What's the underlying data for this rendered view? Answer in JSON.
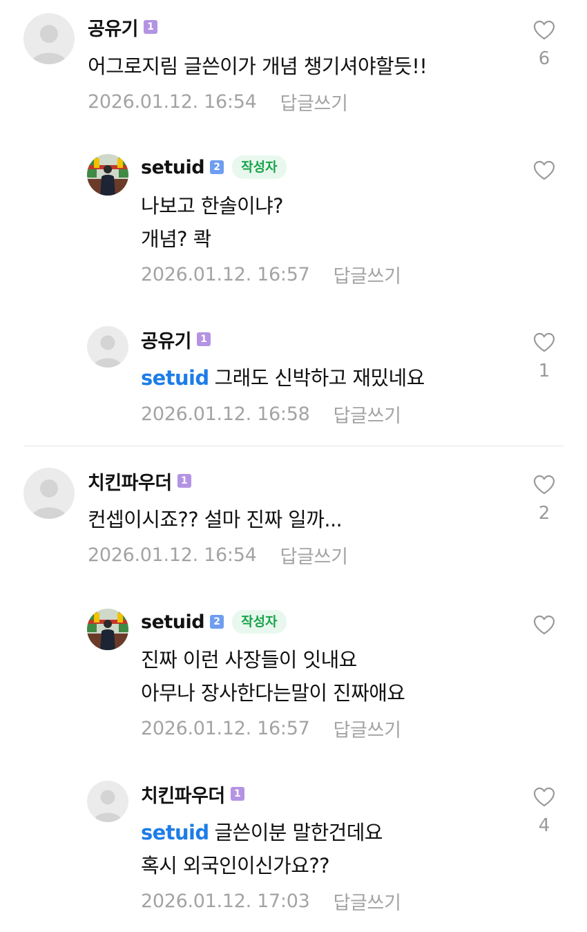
{
  "badges": {
    "level1": "1",
    "level2": "2",
    "author_tag": "작성자",
    "reply_label": "답글쓰기"
  },
  "colors": {
    "mention": "#1e7de6",
    "author_tag_text": "#19a34a",
    "author_tag_bg": "#e9f8ee",
    "level1": "#b493e4",
    "level2": "#6f9df0",
    "meta_gray": "#a3a3a3"
  },
  "comments": [
    {
      "author": "공유기",
      "level": "1",
      "avatar": "default-avatar",
      "lines": [
        "어그로지림 글쓴이가 개념 챙기셔야할듯!!"
      ],
      "timestamp": "2026.01.12. 16:54",
      "likes": "6",
      "replies": [
        {
          "author": "setuid",
          "level": "2",
          "is_writer": true,
          "avatar": "photo-avatar",
          "lines": [
            "나보고 한솔이냐?",
            "개념? 콱"
          ],
          "timestamp": "2026.01.12. 16:57",
          "likes": ""
        },
        {
          "author": "공유기",
          "level": "1",
          "avatar": "default-avatar",
          "mention": "setuid",
          "lines": [
            "그래도 신박하고 재밌네요"
          ],
          "timestamp": "2026.01.12. 16:58",
          "likes": "1"
        }
      ]
    },
    {
      "author": "치킨파우더",
      "level": "1",
      "avatar": "default-avatar",
      "lines": [
        "컨셉이시죠?? 설마 진짜 일까..."
      ],
      "timestamp": "2026.01.12. 16:54",
      "likes": "2",
      "replies": [
        {
          "author": "setuid",
          "level": "2",
          "is_writer": true,
          "avatar": "photo-avatar",
          "lines": [
            "진짜 이런 사장들이 잇내요",
            "아무나 장사한다는말이 진짜애요"
          ],
          "timestamp": "2026.01.12. 16:57",
          "likes": ""
        },
        {
          "author": "치킨파우더",
          "level": "1",
          "avatar": "default-avatar",
          "mention": "setuid",
          "lines": [
            "글쓴이분 말한건데요",
            "혹시 외국인이신가요??"
          ],
          "timestamp": "2026.01.12. 17:03",
          "likes": "4"
        }
      ]
    }
  ]
}
